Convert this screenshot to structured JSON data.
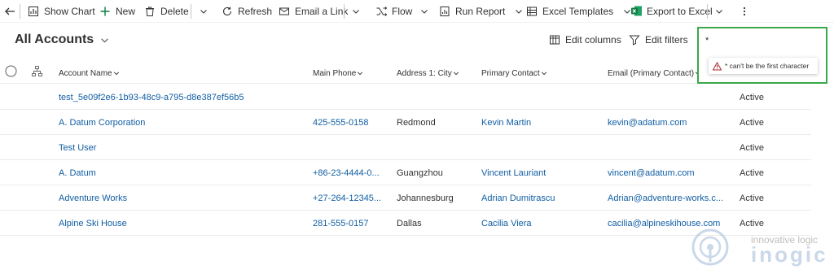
{
  "commandbar": {
    "show_chart": "Show Chart",
    "new": "New",
    "delete": "Delete",
    "refresh": "Refresh",
    "email_link": "Email a Link",
    "flow": "Flow",
    "run_report": "Run Report",
    "excel_templates": "Excel Templates",
    "export_excel": "Export to Excel"
  },
  "view": {
    "title": "All Accounts",
    "edit_columns": "Edit columns",
    "edit_filters": "Edit filters"
  },
  "filter": {
    "value": "*",
    "error": "* can't be the first character"
  },
  "columns": {
    "account_name": "Account Name",
    "main_phone": "Main Phone",
    "city": "Address 1: City",
    "primary_contact": "Primary Contact",
    "email": "Email (Primary Contact)"
  },
  "rows": [
    {
      "name": "test_5e09f2e6-1b93-48c9-a795-d8e387ef56b5",
      "phone": "",
      "city": "",
      "contact": "",
      "email": "",
      "status": "Active"
    },
    {
      "name": "A. Datum Corporation",
      "phone": "425-555-0158",
      "city": "Redmond",
      "contact": "Kevin Martin",
      "email": "kevin@adatum.com",
      "status": "Active"
    },
    {
      "name": "Test User",
      "phone": "",
      "city": "",
      "contact": "",
      "email": "",
      "status": "Active"
    },
    {
      "name": "A. Datum",
      "phone": "+86-23-4444-0...",
      "city": "Guangzhou",
      "contact": "Vincent Lauriant",
      "email": "vincent@adatum.com",
      "status": "Active"
    },
    {
      "name": "Adventure Works",
      "phone": "+27-264-12345...",
      "city": "Johannesburg",
      "contact": "Adrian Dumitrascu",
      "email": "Adrian@adventure-works.c...",
      "status": "Active"
    },
    {
      "name": "Alpine Ski House",
      "phone": "281-555-0157",
      "city": "Dallas",
      "contact": "Cacilia Viera",
      "email": "cacilia@alpineskihouse.com",
      "status": "Active"
    }
  ],
  "watermark": {
    "tagline": "innovative logic",
    "brand": "inogic"
  },
  "colors": {
    "link": "#115ea3",
    "highlight": "#3aa74a",
    "excel": "#107c41",
    "warning": "#a4262c"
  }
}
